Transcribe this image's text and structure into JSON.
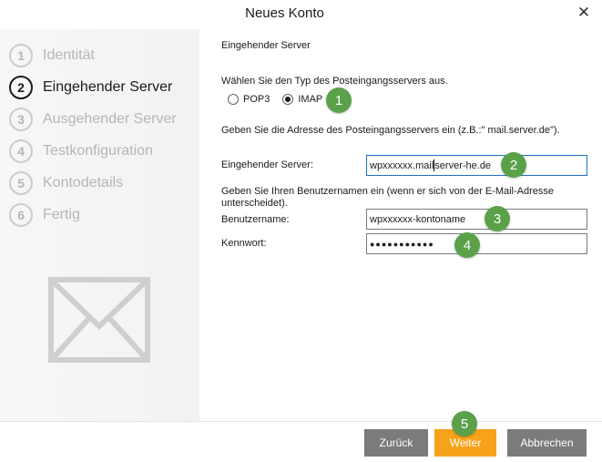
{
  "window": {
    "title": "Neues Konto",
    "close_glyph": "✕"
  },
  "sidebar": {
    "steps": [
      {
        "num": "1",
        "label": "Identität"
      },
      {
        "num": "2",
        "label": "Eingehender Server"
      },
      {
        "num": "3",
        "label": "Ausgehender Server"
      },
      {
        "num": "4",
        "label": "Testkonfiguration"
      },
      {
        "num": "5",
        "label": "Kontodetails"
      },
      {
        "num": "6",
        "label": "Fertig"
      }
    ],
    "active_step": "2",
    "icon": "envelope-icon"
  },
  "form": {
    "section_title": "Eingehender Server",
    "type_prompt": "Wählen Sie den Typ des Posteingangsservers aus.",
    "radio_pop3": "POP3",
    "radio_imap": "IMAP",
    "selected_type": "IMAP",
    "address_prompt": "Geben Sie die Adresse des Posteingangsservers ein (z.B.:\" mail.server.de\").",
    "server_label": "Eingehender Server:",
    "server_value_before_caret": "wpxxxxxx.mail",
    "server_value_after_caret": "server-he.de",
    "username_hint": "Geben Sie Ihren Benutzernamen ein (wenn er sich von der E-Mail-Adresse unterscheidet).",
    "username_label": "Benutzername:",
    "username_value": "wpxxxxxx-kontoname",
    "password_label": "Kennwort:",
    "password_value": "●●●●●●●●●●●"
  },
  "annotations": [
    "1",
    "2",
    "3",
    "4",
    "5"
  ],
  "footer": {
    "back_label": "Zurück",
    "next_label": "Weiter",
    "cancel_label": "Abbrechen"
  },
  "colors": {
    "next_button": "#f7a21b",
    "secondary_button": "#7b7b7b",
    "badge": "#5aa14a",
    "focus_border": "#1e6fc7"
  }
}
